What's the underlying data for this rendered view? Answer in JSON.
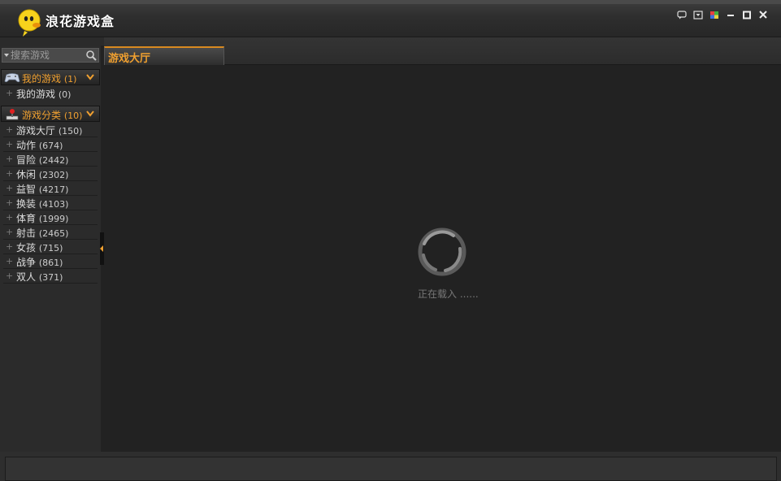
{
  "app": {
    "title": "浪花游戏盒"
  },
  "window_controls": [
    {
      "name": "feedback-icon"
    },
    {
      "name": "menu-icon"
    },
    {
      "name": "skin-icon"
    },
    {
      "name": "minimize-icon"
    },
    {
      "name": "maximize-icon"
    },
    {
      "name": "close-icon"
    }
  ],
  "search": {
    "placeholder": "搜索游戏",
    "value": ""
  },
  "my_games": {
    "label": "我的游戏",
    "count": "(1)",
    "items": [
      {
        "label": "我的游戏",
        "count": "(0)"
      }
    ]
  },
  "categories": {
    "label": "游戏分类",
    "count": "(10)",
    "items": [
      {
        "label": "游戏大厅",
        "count": "(150)"
      },
      {
        "label": "动作",
        "count": "(674)"
      },
      {
        "label": "冒险",
        "count": "(2442)"
      },
      {
        "label": "休闲",
        "count": "(2302)"
      },
      {
        "label": "益智",
        "count": "(4217)"
      },
      {
        "label": "换装",
        "count": "(4103)"
      },
      {
        "label": "体育",
        "count": "(1999)"
      },
      {
        "label": "射击",
        "count": "(2465)"
      },
      {
        "label": "女孩",
        "count": "(715)"
      },
      {
        "label": "战争",
        "count": "(861)"
      },
      {
        "label": "双人",
        "count": "(371)"
      }
    ]
  },
  "tabs": [
    {
      "label": "游戏大厅"
    }
  ],
  "content": {
    "loading_text": "正在载入 ......"
  },
  "colors": {
    "accent": "#f0a030",
    "background": "#222222",
    "sidebar": "#2b2b2b"
  }
}
